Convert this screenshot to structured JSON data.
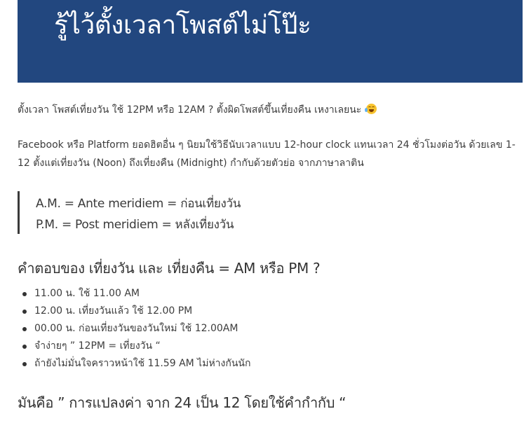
{
  "banner": {
    "title": "รู้ไว้ตั้งเวลาโพสต์ไม่โป๊ะ",
    "background_color": "#22477f"
  },
  "intro": {
    "text": "ตั้งเวลา โพสต์เที่ยงวัน ใช้ 12PM หรือ 12AM ? ตั้งผิดโพสต์ขึ้นเที่ยงคืน เหงาเลยนะ",
    "emoji": "face-with-tears-of-joy-icon"
  },
  "paragraph": {
    "text": "Facebook หรือ Platform ยอดฮิตอื่น ๆ นิยมใช้วิธีนับเวลาแบบ 12-hour clock แทนเวลา 24 ชั่วโมงต่อวัน ด้วยเลข 1-12 ตั้งแต่เที่ยงวัน (Noon) ถึงเที่ยงคืน (Midnight) กำกับด้วยตัวย่อ จากภาษาลาติน"
  },
  "quote": {
    "lines": [
      "A.M. = Ante meridiem = ก่อนเที่ยงวัน",
      "P.M. = Post meridiem = หลังเที่ยงวัน"
    ]
  },
  "section1": {
    "heading": "คำตอบของ เที่ยงวัน และ เที่ยงคืน = AM หรือ PM ?",
    "items": [
      "11.00 น. ใช้ 11.00 AM",
      "12.00 น. เที่ยงวันแล้ว ใช้ 12.00 PM",
      "00.00 น. ก่อนเที่ยงวันของวันใหม่ ใช้ 12.00AM",
      "จำง่ายๆ ” 12PM = เที่ยงวัน “",
      "ถ้ายังไม่มั่นใจคราวหน้าใช้ 11.59 AM ไม่ห่างกันนัก"
    ]
  },
  "section2": {
    "heading": "มันคือ ” การแปลงค่า จาก 24 เป็น 12 โดยใช้คำกำกับ “"
  }
}
